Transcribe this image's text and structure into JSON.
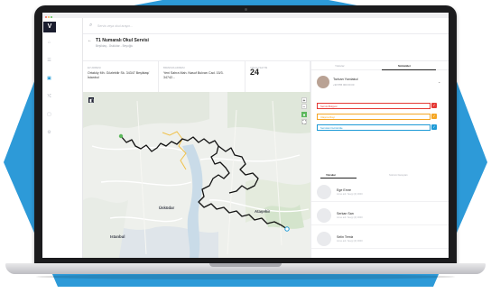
{
  "search": {
    "placeholder": "Servis veya okul arayın..."
  },
  "route": {
    "title": "T1 Numaralı Okul Servisi",
    "subtitle": "Beşiktaş - Üsküdar - Beyoğlu"
  },
  "info": [
    {
      "label": "Ev adresi",
      "value": "Ortaköy Mh. Gözlebilir Sk. 34347 Beşiktaş/İstanbul"
    },
    {
      "label": "Bırakma adresi",
      "value": "Yeni Sahra Mah. Nasuf Bulvarı Cad. 15/3. 34742..."
    },
    {
      "label": "Yolcu sayısı",
      "value": "24"
    }
  ],
  "map": {
    "cities": [
      "Istanbul",
      "Üsküdar",
      "Ataşehir"
    ],
    "zoom_in": "+",
    "zoom_out": "−"
  },
  "panel": {
    "tabs": [
      "Yolcular",
      "Sürücüler"
    ],
    "driver": {
      "name": "Turkan Yurdakul",
      "phone": "+90 555 000 00 00"
    },
    "checks": [
      {
        "label": "Servisi Bulgusi",
        "color": "#e53935"
      },
      {
        "label": "Ulaşma Rayı",
        "color": "#f5a623"
      },
      {
        "label": "Servisleri Görüntüle",
        "color": "#1e9ad6"
      }
    ],
    "subtabs": [
      "Yolcular",
      "Sürücü Detayları"
    ],
    "passengers": [
      {
        "name": "Ege Emre",
        "sub": "Anne adı: Sevgi (0) 0000"
      },
      {
        "name": "Serkan Sarı",
        "sub": "Anne adı: Sevgi (0) 0000"
      },
      {
        "name": "Selin Temiz",
        "sub": "Anne adı: Sevgi (0) 0000"
      }
    ]
  },
  "colors": {
    "accent": "#1e9ad6",
    "hex_bg": "#2d9ad8",
    "route": "#111111"
  }
}
